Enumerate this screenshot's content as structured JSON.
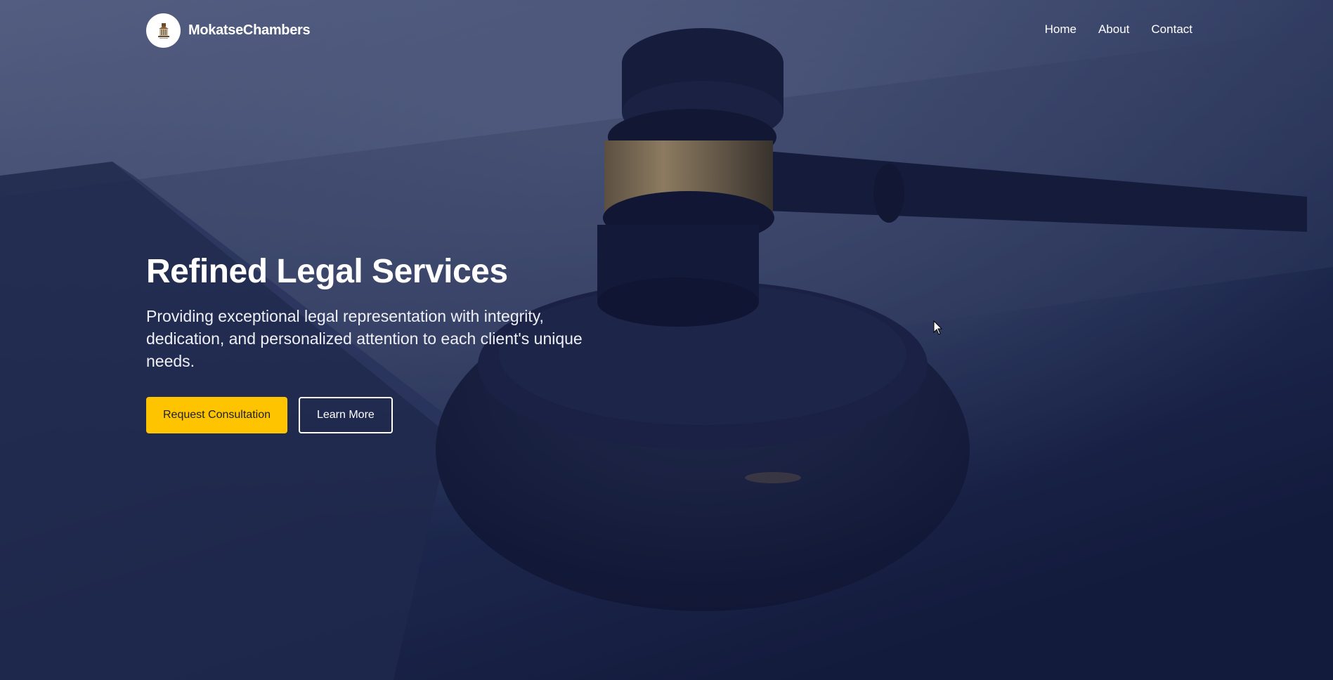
{
  "nav": {
    "brand": "MokatseChambers",
    "logo_icon": "scale-building-logo-icon",
    "links": [
      {
        "label": "Home"
      },
      {
        "label": "About"
      },
      {
        "label": "Contact"
      }
    ]
  },
  "hero": {
    "title": "Refined Legal Services",
    "subtitle": "Providing exceptional legal representation with integrity, dedication, and personalized attention to each client's unique needs.",
    "primary_button": "Request Consultation",
    "secondary_button": "Learn More",
    "background_icon": "gavel-image"
  },
  "colors": {
    "accent": "#fec400",
    "overlay": "#1a2346",
    "text": "#ffffff"
  }
}
